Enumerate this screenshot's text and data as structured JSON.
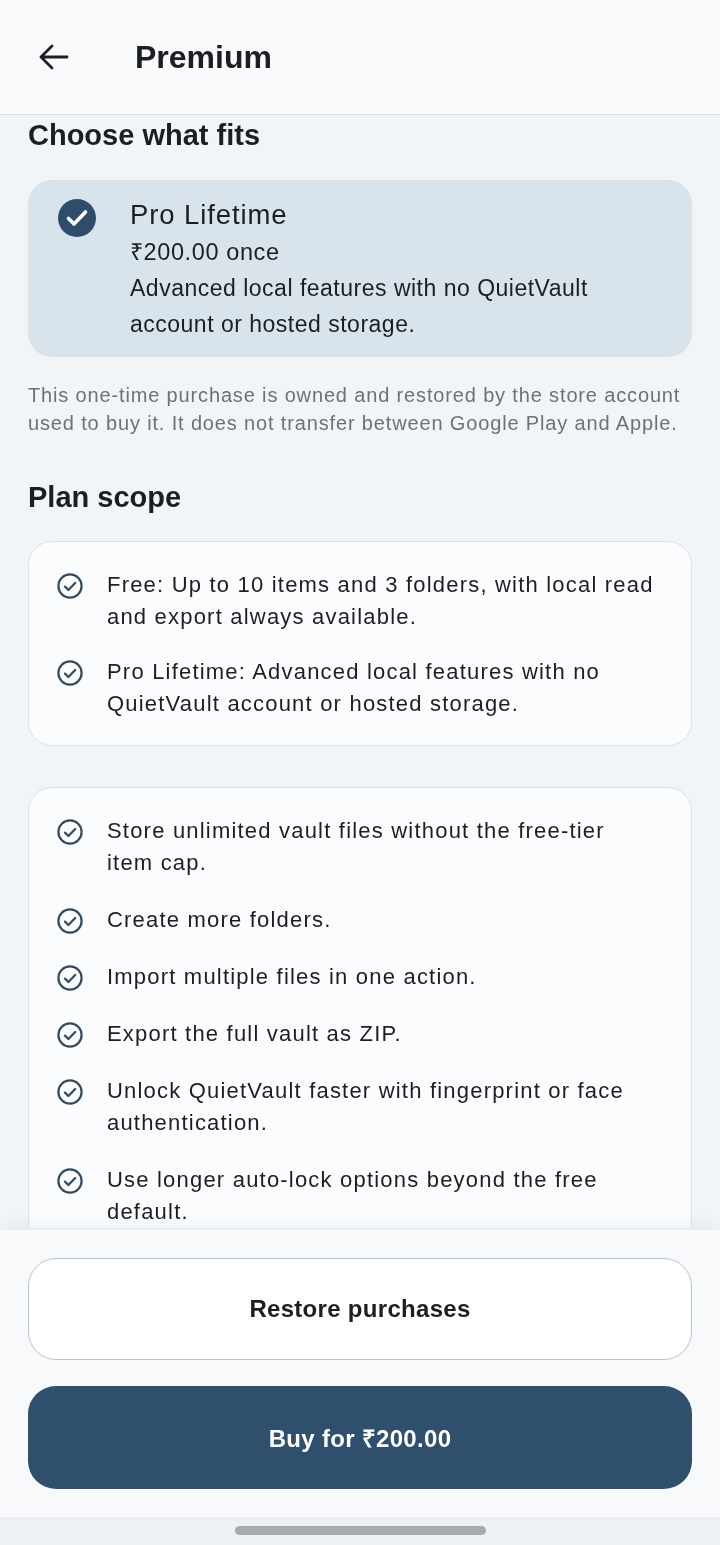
{
  "app_bar": {
    "title": "Premium"
  },
  "plans_section": {
    "heading": "Choose what fits",
    "plans": [
      {
        "name": "Pro Lifetime",
        "price": "₹200.00 once",
        "description": "Advanced local features with no QuietVault account or hosted storage.",
        "selected": true
      }
    ],
    "note": "This one-time purchase is owned and restored by the store account used to buy it. It does not transfer between Google Play and Apple."
  },
  "plan_scope": {
    "heading": "Plan scope",
    "tiers": [
      "Free: Up to 10 items and 3 folders, with local read and export always available.",
      "Pro Lifetime: Advanced local features with no QuietVault account or hosted storage."
    ],
    "features": [
      "Store unlimited vault files without the free-tier item cap.",
      "Create more folders.",
      "Import multiple files in one action.",
      "Export the full vault as ZIP.",
      "Unlock QuietVault faster with fingerprint or face authentication.",
      "Use longer auto-lock options beyond the free default."
    ]
  },
  "actions": {
    "restore_button": "Restore purchases",
    "buy_button": "Buy for ₹200.00"
  }
}
